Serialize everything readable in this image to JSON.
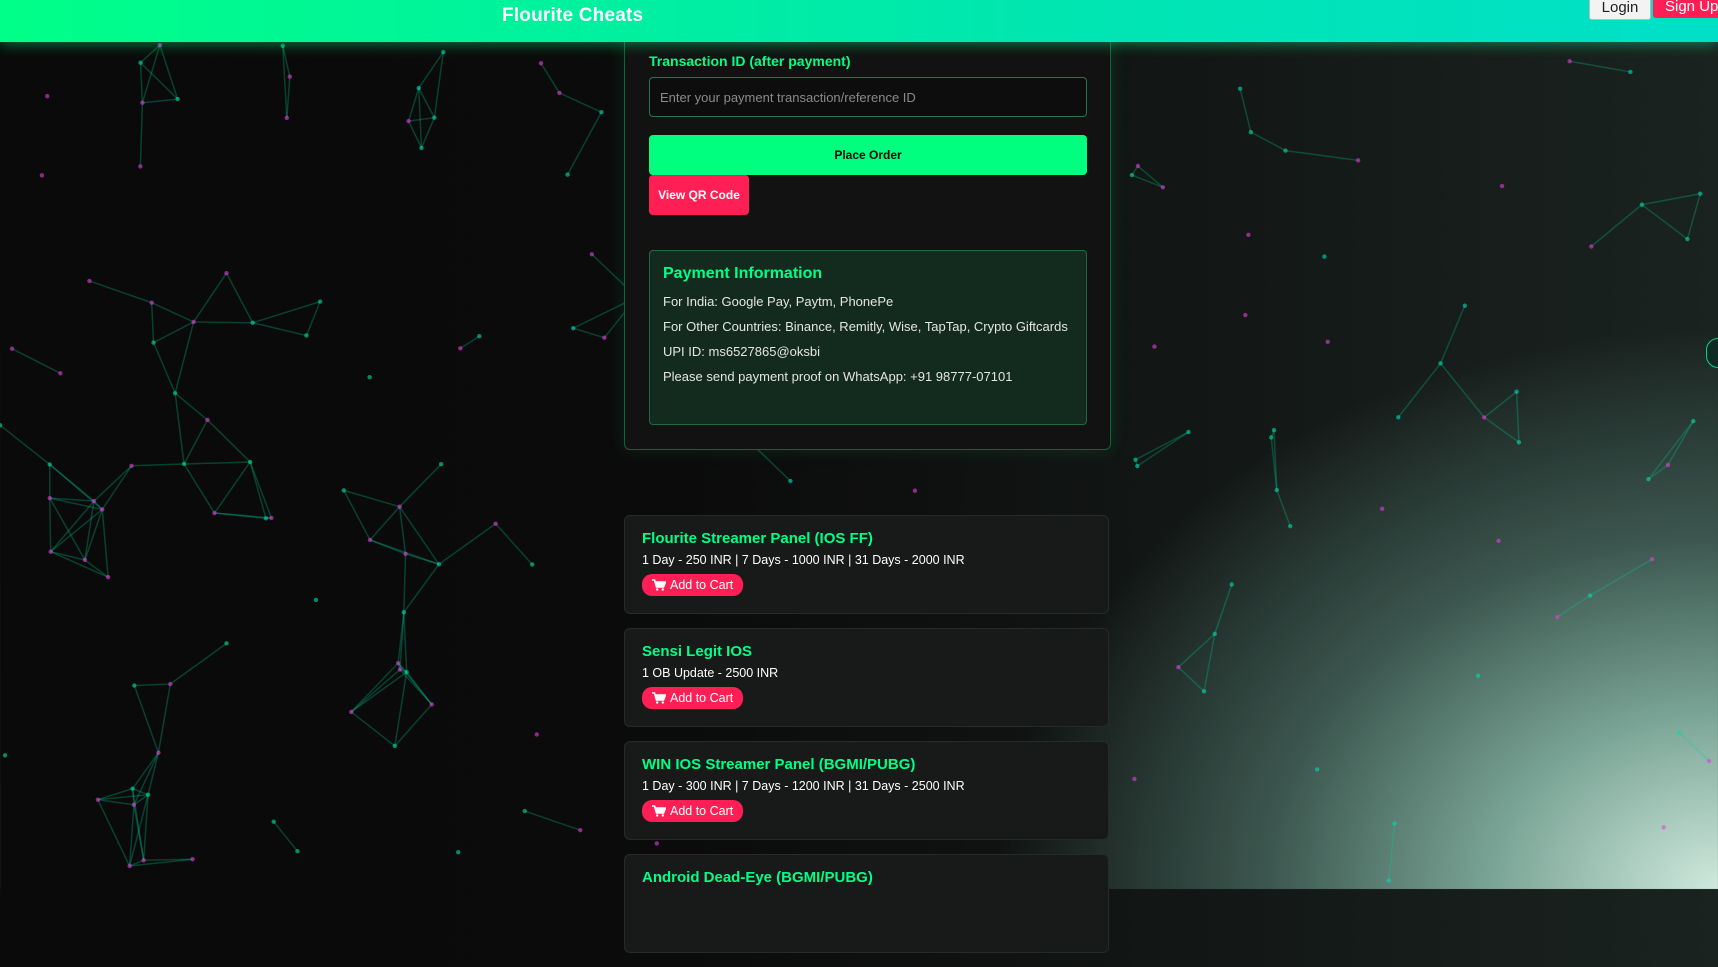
{
  "header": {
    "brand": "Flourite Cheats",
    "login_label": "Login",
    "signup_label": "Sign Up"
  },
  "checkout": {
    "txn_label": "Transaction ID (after payment)",
    "txn_placeholder": "Enter your payment transaction/reference ID",
    "txn_value": "",
    "place_order_label": "Place Order",
    "view_qr_label": "View QR Code"
  },
  "payment_info": {
    "title": "Payment Information",
    "lines": [
      "For India: Google Pay, Paytm, PhonePe",
      "For Other Countries: Binance, Remitly, Wise, TapTap, Crypto Giftcards",
      "UPI ID: ms6527865@oksbi",
      "Please send payment proof on WhatsApp: +91 98777-07101"
    ]
  },
  "products": [
    {
      "title": "Flourite Streamer Panel (IOS FF)",
      "price": "1 Day - 250 INR | 7 Days - 1000 INR | 31 Days - 2000 INR",
      "cart_label": "Add to Cart"
    },
    {
      "title": "Sensi Legit IOS",
      "price": "1 OB Update - 2500 INR",
      "cart_label": "Add to Cart"
    },
    {
      "title": "WIN IOS Streamer Panel (BGMI/PUBG)",
      "price": "1 Day - 300 INR | 7 Days - 1200 INR | 31 Days - 2500 INR",
      "cart_label": "Add to Cart"
    },
    {
      "title": "Android Dead-Eye (BGMI/PUBG)",
      "price": "",
      "cart_label": ""
    }
  ],
  "colors": {
    "accent": "#00ff88",
    "danger": "#ff1f55",
    "background": "#0a0a0a"
  },
  "icons": {
    "cart": "shopping-cart-icon"
  }
}
